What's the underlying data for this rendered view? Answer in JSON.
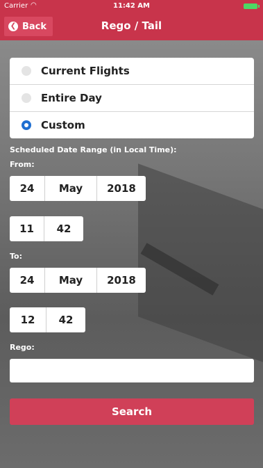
{
  "status_bar": {
    "carrier": "Carrier",
    "wifi_icon": "wifi-icon",
    "time": "11:42 AM",
    "battery_icon": "battery-icon"
  },
  "nav": {
    "back_label": "Back",
    "back_icon": "chevron-left-circle-icon",
    "title": "Rego / Tail"
  },
  "options": [
    {
      "label": "Current Flights",
      "selected": false
    },
    {
      "label": "Entire Day",
      "selected": false
    },
    {
      "label": "Custom",
      "selected": true
    }
  ],
  "form": {
    "range_label": "Scheduled Date Range (in Local Time):",
    "from_label": "From:",
    "from_date": {
      "day": "24",
      "month": "May",
      "year": "2018"
    },
    "from_time": {
      "hour": "11",
      "minute": "42"
    },
    "to_label": "To:",
    "to_date": {
      "day": "24",
      "month": "May",
      "year": "2018"
    },
    "to_time": {
      "hour": "12",
      "minute": "42"
    },
    "rego_label": "Rego:",
    "rego_value": ""
  },
  "search_label": "Search",
  "colors": {
    "brand": "#c8344b",
    "button": "#d04058",
    "radio_selected": "#1f6fd1"
  }
}
